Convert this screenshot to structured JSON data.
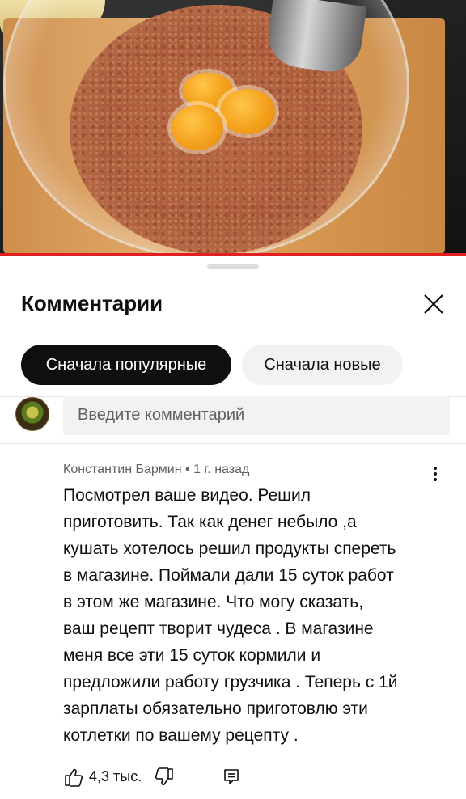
{
  "comments_panel": {
    "title": "Комментарии",
    "close_icon": "close-icon",
    "sort_chips": [
      {
        "label": "Сначала популярные",
        "selected": true
      },
      {
        "label": "Сначала новые",
        "selected": false
      }
    ],
    "input_placeholder": "Введите комментарий"
  },
  "comment": {
    "author": "Константин Бармин",
    "separator": "•",
    "time": "1 г. назад",
    "lines": [
      "Посмотрел ваше видео.  Решил",
      "приготовить.  Так как денег небыло ,а",
      "кушать хотелось  решил продукты спереть",
      "в магазине.  Поймали дали 15 суток работ",
      "в этом же магазине.  Что могу сказать,",
      "ваш рецепт  творит  чудеса . В магазине",
      "меня все эти 15 суток кормили и",
      "предложили работу  грузчика . Теперь с 1й",
      "зарплаты  обязательно  приготовлю эти",
      "котлетки по вашему  рецепту ."
    ],
    "likes": "4,3 тыс.",
    "icons": [
      "thumbs-up-icon",
      "thumbs-down-icon",
      "reply-icon",
      "more-vert-icon"
    ]
  },
  "colors": {
    "text_primary": "#0f0f0f",
    "text_secondary": "#606060",
    "chip_active_bg": "#0f0f0f",
    "chip_inactive_bg": "#f2f2f2",
    "progress_bar": "#e02020"
  }
}
